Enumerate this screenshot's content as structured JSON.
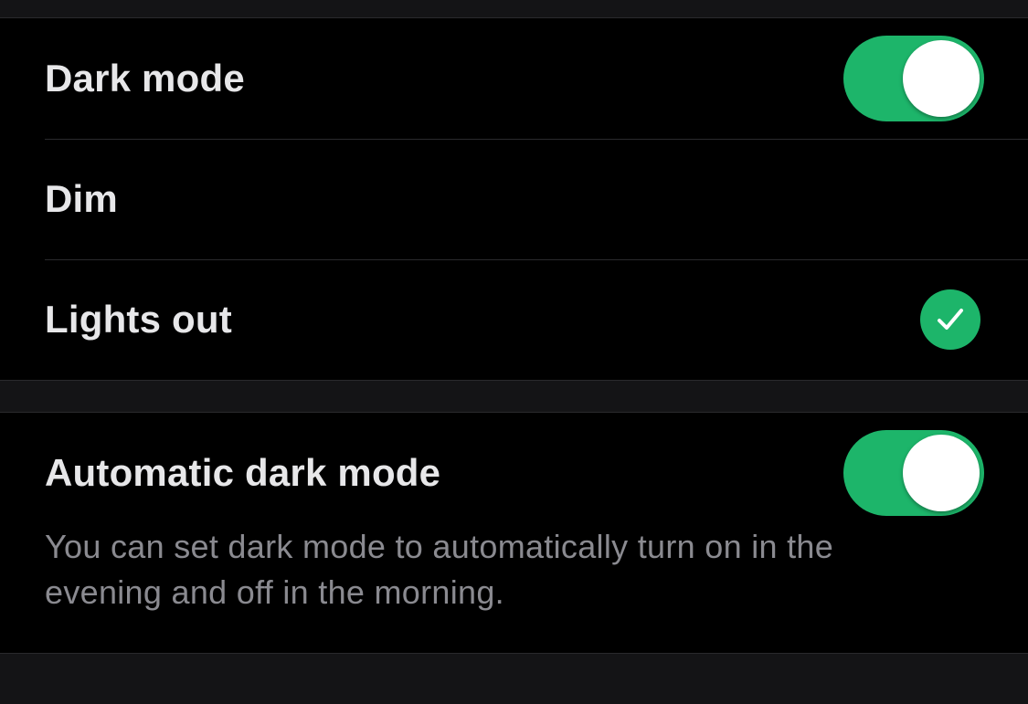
{
  "appearance": {
    "dark_mode": {
      "label": "Dark mode",
      "enabled": true
    },
    "themes": [
      {
        "label": "Dim",
        "selected": false
      },
      {
        "label": "Lights out",
        "selected": true
      }
    ]
  },
  "automatic": {
    "label": "Automatic dark mode",
    "enabled": true,
    "description": "You can set dark mode to automatically turn on in the evening and off in the morning."
  },
  "icons": {
    "selected": "checkmark-icon"
  },
  "colors": {
    "accent": "#1db56a",
    "background": "#000000",
    "separator_background": "#141416",
    "primary_text": "#e7e7e9",
    "secondary_text": "#8a8a90"
  }
}
